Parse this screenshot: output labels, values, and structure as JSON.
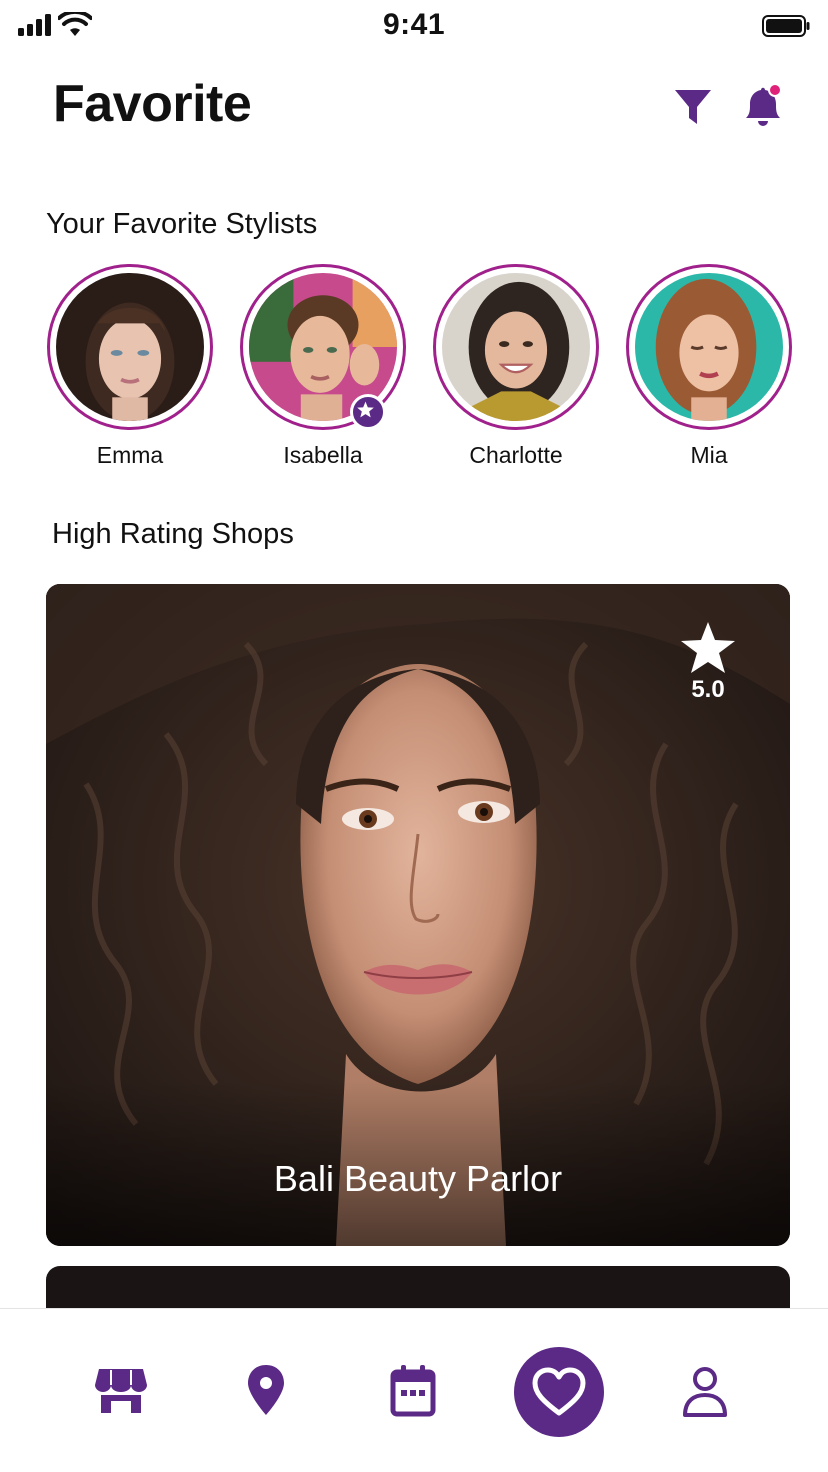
{
  "status_bar": {
    "time": "9:41"
  },
  "header": {
    "title": "Favorite"
  },
  "stylists_section": {
    "title": "Your Favorite Stylists",
    "stylists": [
      {
        "name": "Emma",
        "featured": false
      },
      {
        "name": "Isabella",
        "featured": true
      },
      {
        "name": "Charlotte",
        "featured": false
      },
      {
        "name": "Mia",
        "featured": false
      }
    ]
  },
  "shops_section": {
    "title": "High Rating Shops",
    "shops": [
      {
        "name": "Bali  Beauty Parlor",
        "rating": "5.0"
      }
    ]
  },
  "bottom_nav": {
    "items": [
      "shop-icon",
      "location-pin-icon",
      "calendar-icon",
      "heart-icon",
      "profile-icon"
    ],
    "active": "heart-icon"
  },
  "colors": {
    "accent": "#5b2a86",
    "ring": "#a0208c",
    "notification_dot": "#e0217a"
  }
}
